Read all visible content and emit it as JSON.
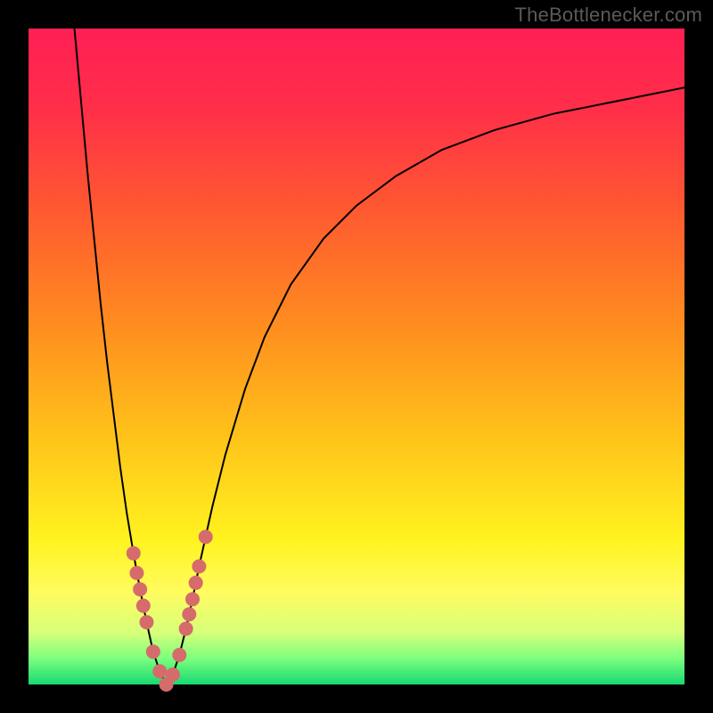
{
  "watermark": {
    "text": "TheBottlenecker.com"
  },
  "colors": {
    "frame": "#000000",
    "gradient_stops": [
      {
        "pos": 0.0,
        "color": "#ff1f54"
      },
      {
        "pos": 0.12,
        "color": "#ff2e49"
      },
      {
        "pos": 0.28,
        "color": "#ff5a30"
      },
      {
        "pos": 0.45,
        "color": "#ff8c1f"
      },
      {
        "pos": 0.62,
        "color": "#ffc21a"
      },
      {
        "pos": 0.78,
        "color": "#fff31f"
      },
      {
        "pos": 0.86,
        "color": "#fffc60"
      },
      {
        "pos": 0.92,
        "color": "#d8ff7a"
      },
      {
        "pos": 0.96,
        "color": "#7dff7d"
      },
      {
        "pos": 1.0,
        "color": "#17da73"
      }
    ],
    "curve": "#000000",
    "dot": "#d66b6b"
  },
  "chart_data": {
    "type": "line",
    "title": "",
    "xlabel": "",
    "ylabel": "",
    "xlim": [
      0,
      100
    ],
    "ylim": [
      0,
      100
    ],
    "grid": false,
    "series": [
      {
        "name": "bottleneck-curve",
        "min_x": 21,
        "x": [
          7,
          8,
          9,
          10,
          11,
          12,
          13,
          14,
          15,
          16,
          17,
          18,
          19,
          20,
          21,
          22,
          23,
          24,
          25,
          26,
          28,
          30,
          33,
          36,
          40,
          45,
          50,
          56,
          63,
          71,
          80,
          90,
          100
        ],
        "y": [
          100,
          89,
          78,
          68,
          58,
          49,
          41,
          33,
          26,
          20,
          14.5,
          9.5,
          5,
          2,
          0,
          1.5,
          4.5,
          8.5,
          13,
          18,
          27,
          35,
          45,
          53,
          61,
          68,
          73,
          77.5,
          81.5,
          84.5,
          87,
          89,
          91
        ]
      }
    ],
    "sample_dots": [
      {
        "x": 16.0,
        "y": 20.0
      },
      {
        "x": 16.5,
        "y": 17.0
      },
      {
        "x": 17.0,
        "y": 14.5
      },
      {
        "x": 17.5,
        "y": 12.0
      },
      {
        "x": 18.0,
        "y": 9.5
      },
      {
        "x": 19.0,
        "y": 5.0
      },
      {
        "x": 20.0,
        "y": 2.0
      },
      {
        "x": 21.0,
        "y": 0.0
      },
      {
        "x": 22.0,
        "y": 1.5
      },
      {
        "x": 23.0,
        "y": 4.5
      },
      {
        "x": 24.0,
        "y": 8.5
      },
      {
        "x": 24.5,
        "y": 10.7
      },
      {
        "x": 25.0,
        "y": 13.0
      },
      {
        "x": 25.5,
        "y": 15.5
      },
      {
        "x": 26.0,
        "y": 18.0
      },
      {
        "x": 27.0,
        "y": 22.5
      }
    ]
  }
}
